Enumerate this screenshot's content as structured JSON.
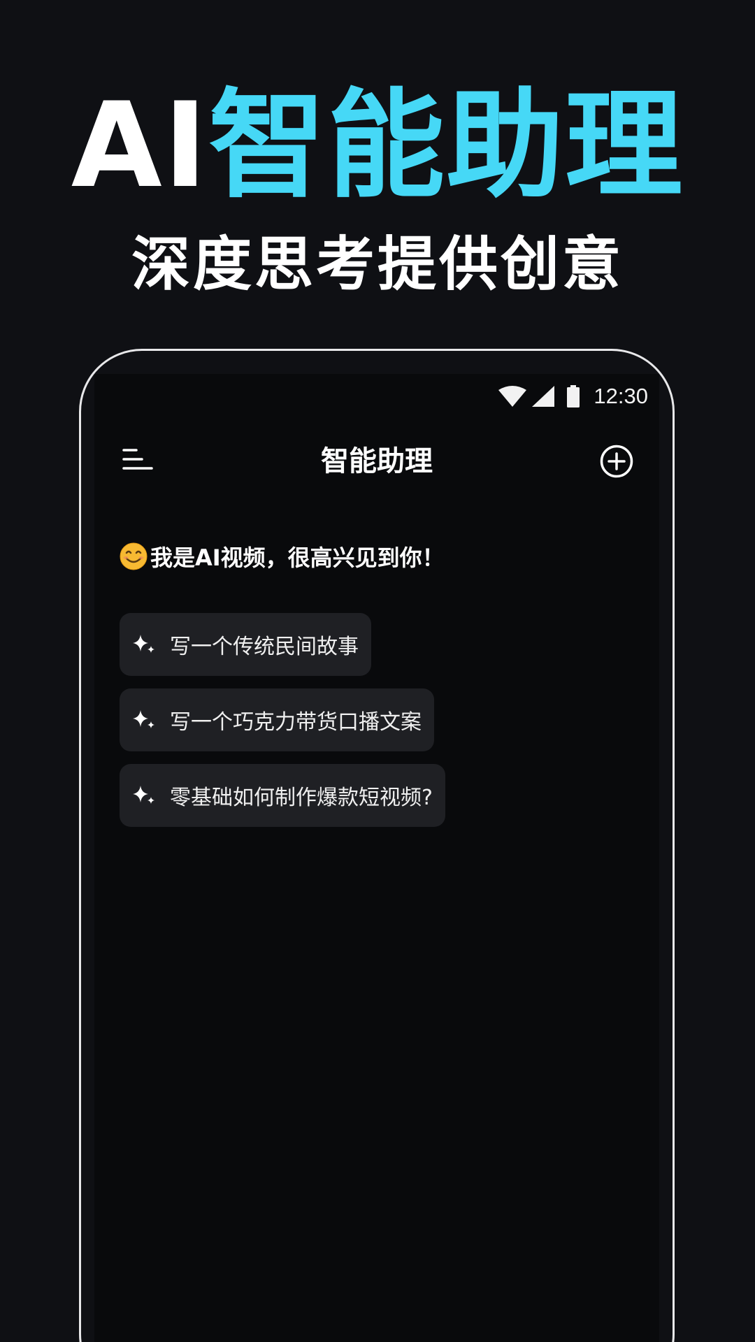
{
  "hero": {
    "title_ai": "AI",
    "title_rest": "智能助理",
    "subtitle": "深度思考提供创意"
  },
  "status_bar": {
    "time": "12:30",
    "icons": [
      "wifi-icon",
      "cellular-signal-icon",
      "battery-icon"
    ]
  },
  "app_bar": {
    "title": "智能助理",
    "left_icon": "menu-icon",
    "right_icon": "add-circle-icon"
  },
  "chat": {
    "greeting_emoji": "smiling-face-icon",
    "greeting": "我是AI视频，很高兴见到你！",
    "suggestions": [
      {
        "icon": "sparkle-icon",
        "label": "写一个传统民间故事"
      },
      {
        "icon": "sparkle-icon",
        "label": "写一个巧克力带货口播文案"
      },
      {
        "icon": "sparkle-icon",
        "label": "零基础如何制作爆款短视频?"
      }
    ]
  },
  "colors": {
    "page_background": "#0f1014",
    "screen_background": "#090a0c",
    "accent": "#46d8f6",
    "chip_background": "#1f2024",
    "text": "#ffffff"
  }
}
